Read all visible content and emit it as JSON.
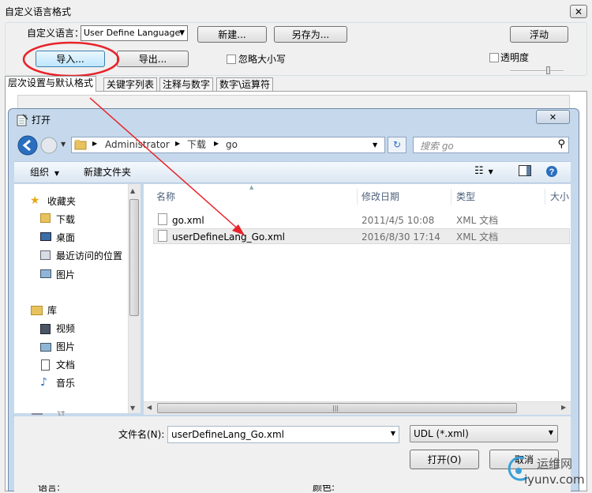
{
  "main_window": {
    "title": "自定义语言格式",
    "lang_label": "自定义语言：",
    "lang_value": "User Define Language",
    "new_btn": "新建...",
    "saveas_btn": "另存为...",
    "float_btn": "浮动",
    "import_btn": "导入...",
    "export_btn": "导出...",
    "ignore_case": "忽略大小写",
    "transparency": "透明度",
    "tabs": [
      "层次设置与默认格式",
      "关键字列表",
      "注释与数字",
      "数字\\运算符"
    ],
    "bottom_left": "语言:",
    "bottom_right": "颜色:"
  },
  "dialog": {
    "title": "打开",
    "breadcrumb": [
      "Administrator",
      "下载",
      "go"
    ],
    "search_placeholder": "搜索 go",
    "organize": "组织",
    "new_folder": "新建文件夹",
    "nav": {
      "favorites": "收藏夹",
      "downloads": "下载",
      "desktop": "桌面",
      "recent": "最近访问的位置",
      "pictures": "图片",
      "libraries": "库",
      "videos": "视频",
      "lib_pictures": "图片",
      "documents": "文档",
      "music": "音乐",
      "computer": "计"
    },
    "columns": {
      "name": "名称",
      "modified": "修改日期",
      "type": "类型",
      "size": "大小"
    },
    "files": [
      {
        "name": "go.xml",
        "modified": "2011/4/5 10:08",
        "type": "XML 文档"
      },
      {
        "name": "userDefineLang_Go.xml",
        "modified": "2016/8/30 17:14",
        "type": "XML 文档"
      }
    ],
    "filename_label": "文件名(N):",
    "filename_value": "userDefineLang_Go.xml",
    "filter_value": "UDL (*.xml)",
    "open_btn": "打开(O)",
    "cancel_btn": "取消"
  },
  "watermark": {
    "brand": "运维网",
    "url": "iyunv.com"
  },
  "colors": {
    "highlight_circle": "#e8232a",
    "arrow": "#e8232a",
    "dialog_frame": "#c6d9ec",
    "row_selected": "#e8e8e8"
  }
}
